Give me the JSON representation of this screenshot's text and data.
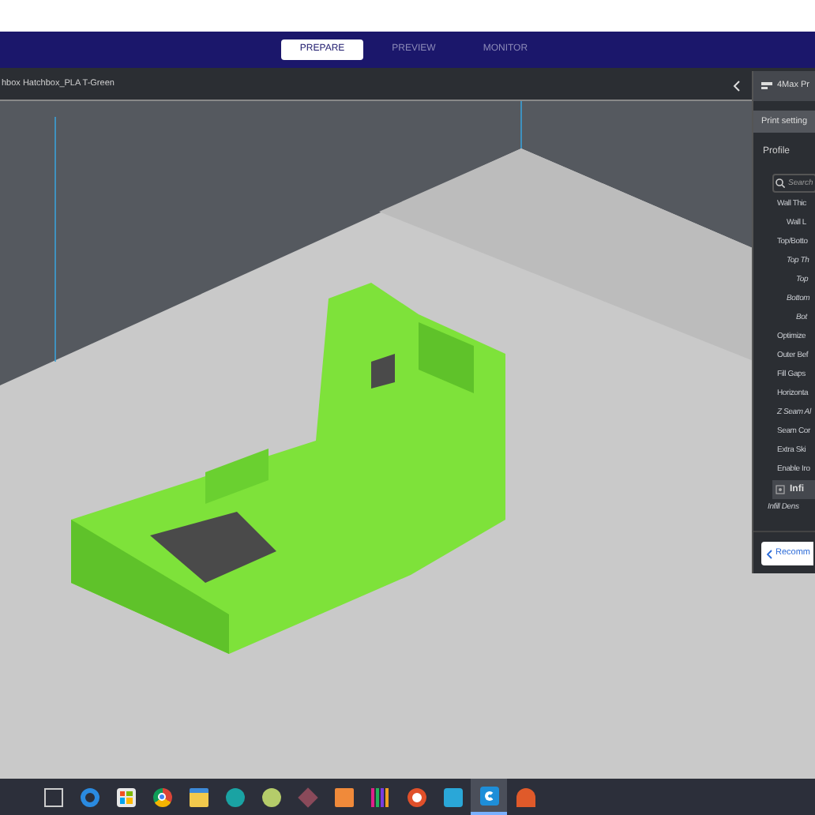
{
  "stages": [
    {
      "label": "PREPARE",
      "selected": true
    },
    {
      "label": "PREVIEW",
      "selected": false
    },
    {
      "label": "MONITOR",
      "selected": false
    }
  ],
  "material": "hbox Hatchbox_PLA T-Green",
  "panel": {
    "printer": "4Max Pr",
    "header": "Print setting",
    "profile": "Profile",
    "search": {
      "placeholder": "Search"
    },
    "settings": [
      {
        "label": "Wall Thic",
        "italic": false,
        "children": [
          {
            "label": "Wall L",
            "italic": false
          }
        ]
      },
      {
        "label": "Top/Botto",
        "italic": false,
        "children": [
          {
            "label": "Top Th",
            "italic": true,
            "children": [
              {
                "label": "Top",
                "italic": true
              }
            ]
          },
          {
            "label": "Bottom",
            "italic": true,
            "children": [
              {
                "label": "Bot",
                "italic": true
              }
            ]
          }
        ]
      },
      {
        "label": "Optimize",
        "italic": false
      },
      {
        "label": "Outer Bef",
        "italic": false
      },
      {
        "label": "Fill Gaps",
        "italic": false
      },
      {
        "label": "Horizonta",
        "italic": false
      },
      {
        "label": "Z Seam Al",
        "italic": true
      },
      {
        "label": "Seam Cor",
        "italic": false
      },
      {
        "label": "Extra Ski",
        "italic": false
      },
      {
        "label": "Enable Iro",
        "italic": false
      }
    ],
    "section": "Infi",
    "after": [
      {
        "label": "Infill Dens",
        "italic": true
      }
    ],
    "button": "Recomm"
  },
  "taskbar": [
    {
      "kind": "taskview"
    },
    {
      "kind": "edge"
    },
    {
      "kind": "store"
    },
    {
      "kind": "chrome"
    },
    {
      "kind": "folder"
    },
    {
      "kind": "arduino"
    },
    {
      "kind": "disc",
      "color": "#b5cc6a"
    },
    {
      "kind": "cube"
    },
    {
      "kind": "letter",
      "color": "#f08a3a"
    },
    {
      "kind": "bars"
    },
    {
      "kind": "round"
    },
    {
      "kind": "wave"
    },
    {
      "kind": "cura",
      "selected": true
    },
    {
      "kind": "dome"
    }
  ]
}
